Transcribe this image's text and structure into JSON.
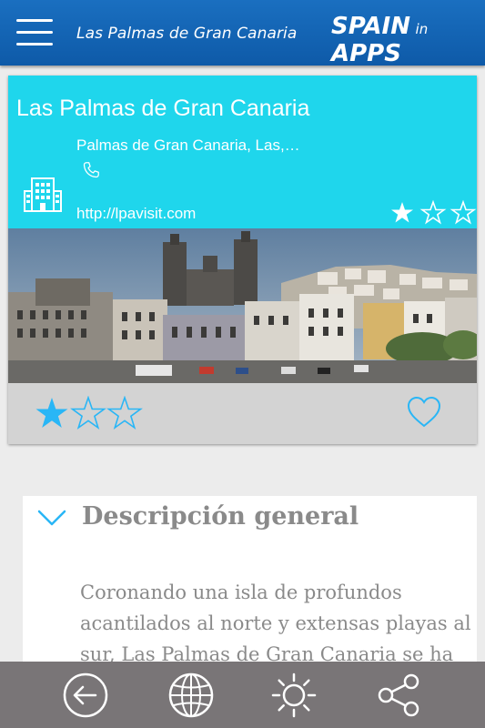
{
  "header": {
    "menu_icon": "hamburger-menu-icon",
    "title": "Las Palmas de Gran Canaria",
    "logo_big1": "SPAIN",
    "logo_small": "in",
    "logo_big2": "APPS"
  },
  "place": {
    "title": "Las Palmas de Gran Canaria",
    "address": "Palmas de Gran Canaria, Las,…",
    "phone_icon": "phone-icon",
    "building_icon": "building-icon",
    "url": "http://lpavisit.com",
    "rating": 1,
    "rating_max": 3
  },
  "user_rating": {
    "value": 1,
    "max": 3,
    "favorite_icon": "heart-icon"
  },
  "description": {
    "heading": "Descripción general",
    "text": "Coronando una isla de profundos acantilados al norte y extensas playas al sur, Las Palmas de Gran Canaria se ha"
  },
  "nav": {
    "back": "back-icon",
    "web": "globe-icon",
    "weather": "sun-icon",
    "share": "share-icon"
  },
  "colors": {
    "header": "#1565b8",
    "banner": "#1fd6ec",
    "star_accent": "#29b6f6",
    "nav_bar": "#797577"
  }
}
